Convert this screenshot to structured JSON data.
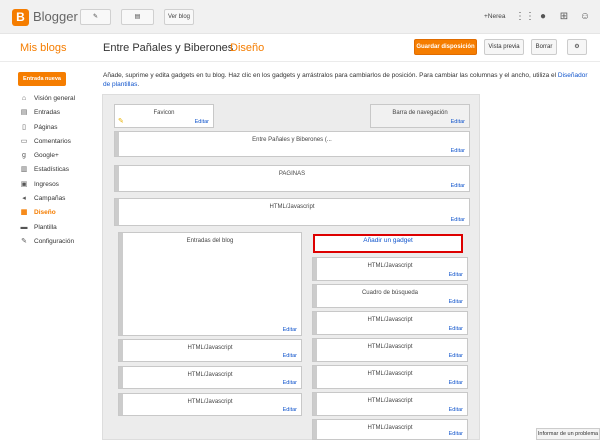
{
  "topbar": {
    "logo_letter": "B",
    "brand": "Blogger",
    "view_blog": "Ver blog",
    "user": "+Nerea"
  },
  "header": {
    "my_blogs": "Mis blogs",
    "blog_title": "Entre Pañales y Biberones",
    "separator": "·",
    "section": "Diseño",
    "save_button": "Guardar disposición",
    "preview_button": "Vista previa",
    "delete_button": "Borrar"
  },
  "sidebar": {
    "new_entry": "Entrada nueva",
    "items": [
      {
        "label": "Visión general",
        "icon": "home-icon"
      },
      {
        "label": "Entradas",
        "icon": "posts-icon"
      },
      {
        "label": "Páginas",
        "icon": "pages-icon"
      },
      {
        "label": "Comentarios",
        "icon": "comments-icon"
      },
      {
        "label": "Google+",
        "icon": "googleplus-icon"
      },
      {
        "label": "Estadísticas",
        "icon": "stats-icon"
      },
      {
        "label": "Ingresos",
        "icon": "earnings-icon"
      },
      {
        "label": "Campañas",
        "icon": "campaigns-icon"
      },
      {
        "label": "Diseño",
        "icon": "layout-icon"
      },
      {
        "label": "Plantilla",
        "icon": "template-icon"
      },
      {
        "label": "Configuración",
        "icon": "settings-icon"
      }
    ]
  },
  "intro": {
    "text": "Añade, suprime y edita gadgets en tu blog. Haz clic en los gadgets y arrástralos para cambiarlos de posición. Para cambiar las columnas y el ancho, utiliza el ",
    "link": "Diseñador de plantillas",
    "end": "."
  },
  "layout": {
    "edit": "Editar",
    "favicon": "Favicon",
    "navbar": "Barra de navegación",
    "header_gadget": "Entre Pañales y Biberones (...",
    "paginas": "PAGINAS",
    "html1": "HTML/Javascript",
    "main_posts": "Entradas del blog",
    "left_html": [
      "HTML/Javascript",
      "HTML/Javascript",
      "HTML/Javascript"
    ],
    "add_gadget": "Añadir un gadget",
    "right_gadgets": [
      "HTML/Javascript",
      "Cuadro de búsqueda",
      "HTML/Javascript",
      "HTML/Javascript",
      "HTML/Javascript",
      "HTML/Javascript",
      "HTML/Javascript"
    ]
  },
  "footer": {
    "report": "Informar de un problema"
  },
  "colors": {
    "accent": "#f57d00",
    "link": "#1155cc",
    "highlight": "#dd0000"
  }
}
